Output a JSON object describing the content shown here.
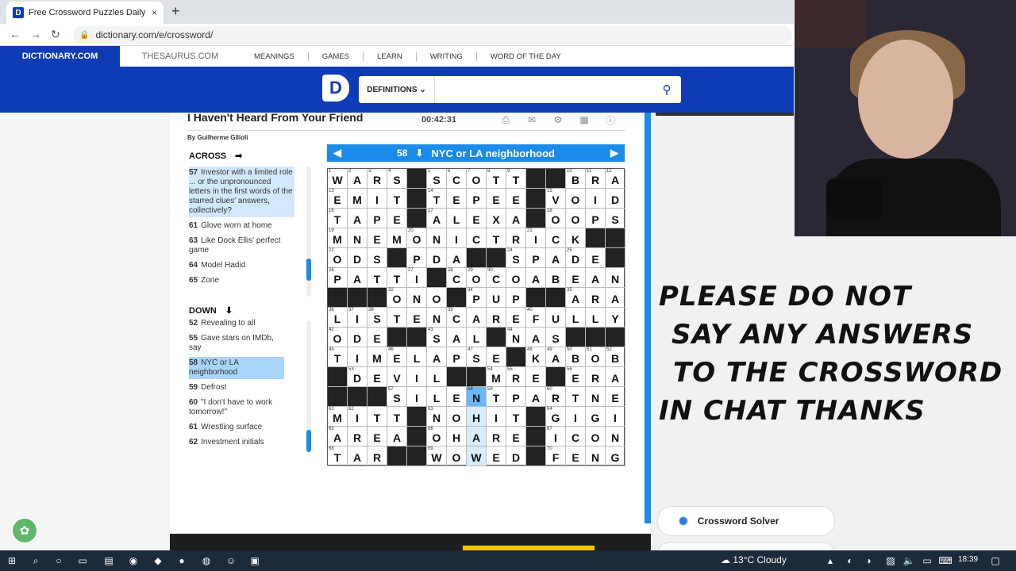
{
  "browser": {
    "tab_title": "Free Crossword Puzzles Daily | Di",
    "tab_close": "×",
    "new_tab": "+",
    "url": "dictionary.com/e/crossword/"
  },
  "site": {
    "nav_dictionary": "DICTIONARY.COM",
    "nav_thesaurus": "THESAURUS.COM",
    "menu": [
      "MEANINGS",
      "GAMES",
      "LEARN",
      "WRITING",
      "WORD OF THE DAY"
    ],
    "search_dropdown": "DEFINITIONS",
    "logo": "D"
  },
  "puzzle": {
    "title": "I Haven't Heard From Your Friend",
    "byline": "By Guilherme Gilioli",
    "timer": "00:42:31"
  },
  "clues": {
    "across_heading": "ACROSS",
    "down_heading": "DOWN",
    "across": [
      {
        "num": "57",
        "text": "Investor with a limited role ... or the unpronounced letters in the first words of the starred clues' answers, collectively?",
        "state": "hl"
      },
      {
        "num": "61",
        "text": "Glove worn at home",
        "state": ""
      },
      {
        "num": "63",
        "text": "Like Dock Ellis' perfect game",
        "state": ""
      },
      {
        "num": "64",
        "text": "Model Hadid",
        "state": ""
      },
      {
        "num": "65",
        "text": "Zone",
        "state": ""
      }
    ],
    "down": [
      {
        "num": "52",
        "text": "Revealing to all",
        "state": ""
      },
      {
        "num": "55",
        "text": "Gave stars on IMDb, say",
        "state": ""
      },
      {
        "num": "58",
        "text": "NYC or LA neighborhood",
        "state": "sel"
      },
      {
        "num": "59",
        "text": "Defrost",
        "state": ""
      },
      {
        "num": "60",
        "text": "\"I don't have to work tomorrow!\"",
        "state": ""
      },
      {
        "num": "61",
        "text": "Wrestling surface",
        "state": ""
      },
      {
        "num": "62",
        "text": "Investment initials",
        "state": ""
      }
    ]
  },
  "active_clue": {
    "number": "58",
    "text": "NYC or LA neighborhood"
  },
  "grid": {
    "rows": [
      "WARS#SCOTT##BRA",
      "EMIT#TEPEE#VOID",
      "TAPE#ALEXA#OOPS",
      "MNEMONICTRICK##",
      "ODS#PDA##SPADE#",
      "PATTI#COCOABEAN",
      "###ONO#PUP##ARA",
      "LISTENCAREFULLY",
      "ODE##SAL#NAS###",
      "TIMELAPSE#KABOB",
      "#DEVIL##MRE#ERA",
      "###SILENTPARTNER",
      "MITT#NOHIT#GIGI",
      "AREA#OHARE#ICON",
      "TAR##WOWED#FENG"
    ],
    "numbers": [
      [
        "1",
        "2",
        "3",
        "4",
        "",
        "5",
        "6",
        "7",
        "8",
        "9",
        "",
        "",
        "10",
        "11",
        "12"
      ],
      [
        "13",
        "",
        "",
        "",
        "",
        "14",
        "",
        "",
        "",
        "",
        "",
        "15",
        "",
        "",
        ""
      ],
      [
        "16",
        "",
        "",
        "",
        "",
        "17",
        "",
        "",
        "",
        "",
        "",
        "18",
        "",
        "",
        ""
      ],
      [
        "19",
        "",
        "",
        "",
        "20",
        "",
        "",
        "",
        "",
        "",
        "21",
        "",
        "",
        "",
        ""
      ],
      [
        "22",
        "",
        "",
        "23",
        "",
        "",
        "",
        "",
        "",
        "24",
        "",
        "",
        "25",
        "",
        ""
      ],
      [
        "26",
        "",
        "",
        "",
        "27",
        "",
        "28",
        "29",
        "30",
        "",
        "",
        "",
        "",
        "",
        ""
      ],
      [
        "",
        "",
        "",
        "32",
        "",
        "",
        "",
        "34",
        "",
        "",
        "",
        "",
        "35",
        "",
        ""
      ],
      [
        "36",
        "37",
        "38",
        "",
        "",
        "",
        "39",
        "",
        "",
        "",
        "40",
        "",
        "",
        "",
        ""
      ],
      [
        "42",
        "",
        "",
        "",
        "",
        "43",
        "",
        "",
        "",
        "44",
        "",
        "",
        "",
        "",
        ""
      ],
      [
        "45",
        "",
        "",
        "46",
        "",
        "",
        "",
        "47",
        "",
        "",
        "48",
        "49",
        "50",
        "51",
        "52"
      ],
      [
        "",
        "53",
        "",
        "",
        "",
        "",
        "",
        "",
        "54",
        "55",
        "",
        "",
        "56",
        "",
        ""
      ],
      [
        "",
        "",
        "",
        "57",
        "",
        "",
        "",
        "58",
        "59",
        "",
        "",
        "60",
        "",
        "",
        ""
      ],
      [
        "61",
        "62",
        "",
        "",
        "",
        "63",
        "",
        "",
        "",
        "",
        "",
        "64",
        "",
        "",
        ""
      ],
      [
        "65",
        "",
        "",
        "",
        "",
        "66",
        "",
        "",
        "",
        "",
        "",
        "67",
        "",
        "",
        ""
      ],
      [
        "68",
        "",
        "",
        "",
        "",
        "69",
        "",
        "",
        "",
        "",
        "",
        "70",
        "",
        "",
        ""
      ]
    ],
    "current_row": 11,
    "current_col": 7,
    "word_col": 7,
    "word_rows": [
      11,
      12,
      13,
      14
    ]
  },
  "overlay": {
    "notice": [
      "PLEASE DO NOT",
      "SAY ANY ANSWERS",
      "TO THE CROSSWORD",
      "IN CHAT THANKS"
    ],
    "solver_label": "Crossword Solver"
  },
  "taskbar": {
    "weather": "13°C  Cloudy",
    "time": "18:39"
  }
}
